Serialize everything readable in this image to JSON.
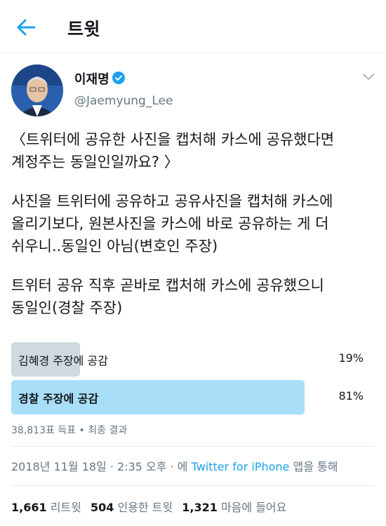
{
  "header": {
    "title": "트윗"
  },
  "author": {
    "name": "이재명",
    "handle": "@Jaemyung_Lee"
  },
  "tweet": {
    "paragraphs": [
      "〈트위터에 공유한 사진을 캡처해 카스에 공유했다면\n계정주는 동일인일까요? 〉",
      "사진을 트위터에 공유하고 공유사진을 캡처해 카스에\n올리기보다, 원본사진을 카스에 바로 공유하는 게 더\n쉬우니..동일인 아님(변호인 주장)",
      "트위터 공유 직후 곧바로 캡처해 카스에 공유했으니\n동일인(경찰 주장)"
    ]
  },
  "poll": {
    "options": [
      {
        "label": "김혜경 주장에 공감",
        "percent_text": "19%",
        "percent": 19,
        "winner": false
      },
      {
        "label": "경찰 주장에 공감",
        "percent_text": "81%",
        "percent": 81,
        "winner": true
      }
    ],
    "votes": "38,813표 득표",
    "separator": "•",
    "status": "최종 결과"
  },
  "timestamp": {
    "time": "2018년 11월 18일 · 2:35 오후 · 에",
    "source": "Twitter for iPhone",
    "suffix": "앱을 통해"
  },
  "stats": {
    "retweets_count": "1,661",
    "retweets_label": "리트윗",
    "quotes_count": "504",
    "quotes_label": "인용한 트윗",
    "likes_count": "1,321",
    "likes_label": "마음에 들어요"
  },
  "colors": {
    "accent": "#1da1f2",
    "poll_winner": "#a9def9",
    "poll_loser": "#cfd9de",
    "secondary_text": "#657786"
  },
  "icons": [
    "back-arrow-icon",
    "verified-badge-icon",
    "chevron-down-icon"
  ]
}
